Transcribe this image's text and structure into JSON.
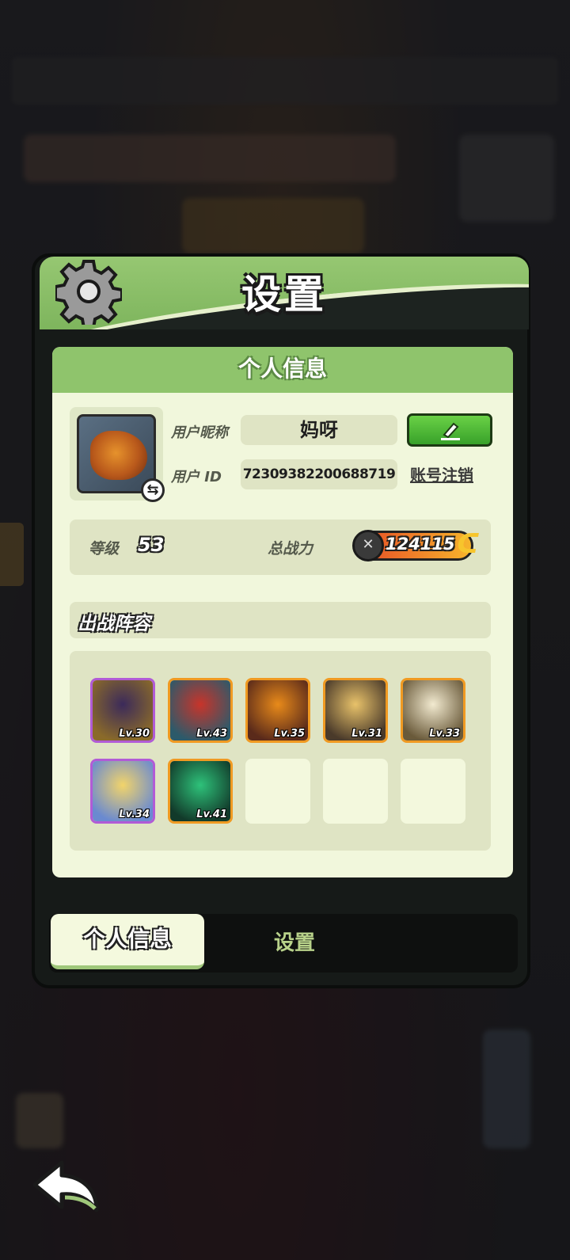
{
  "window": {
    "title": "设置"
  },
  "card": {
    "header": "个人信息"
  },
  "profile": {
    "nickname_label": "用户昵称",
    "nickname": "妈呀",
    "id_label": "用户 ID",
    "user_id": "7230938220068871​9",
    "cancel_account": "账号注销"
  },
  "stats": {
    "level_label": "等级",
    "level": "53",
    "power_label": "总战力",
    "power": "124115"
  },
  "lineup": {
    "title": "出战阵容",
    "heroes": [
      {
        "level": "Lv.30",
        "rarity": "purple",
        "colors": [
          "#3b2a5a",
          "#8a6a2a"
        ]
      },
      {
        "level": "Lv.43",
        "rarity": "orange",
        "colors": [
          "#c8342a",
          "#2c5a6a"
        ]
      },
      {
        "level": "Lv.35",
        "rarity": "orange",
        "colors": [
          "#e88a1a",
          "#5a2a1a"
        ]
      },
      {
        "level": "Lv.31",
        "rarity": "orange",
        "colors": [
          "#e8c26a",
          "#4a3a2a"
        ]
      },
      {
        "level": "Lv.33",
        "rarity": "orange",
        "colors": [
          "#f2ead0",
          "#6a5a3a"
        ]
      },
      {
        "level": "Lv.34",
        "rarity": "purple",
        "colors": [
          "#f2d46a",
          "#6a8ad0"
        ]
      },
      {
        "level": "Lv.41",
        "rarity": "orange",
        "colors": [
          "#2ec27a",
          "#123a2a"
        ]
      }
    ],
    "empty_slots": 3
  },
  "tabs": {
    "active": "个人信息",
    "other": "设置"
  },
  "icons": {
    "gear": "gear-icon",
    "edit": "pencil-icon",
    "back": "back-arrow-icon",
    "power": "swords-icon"
  }
}
